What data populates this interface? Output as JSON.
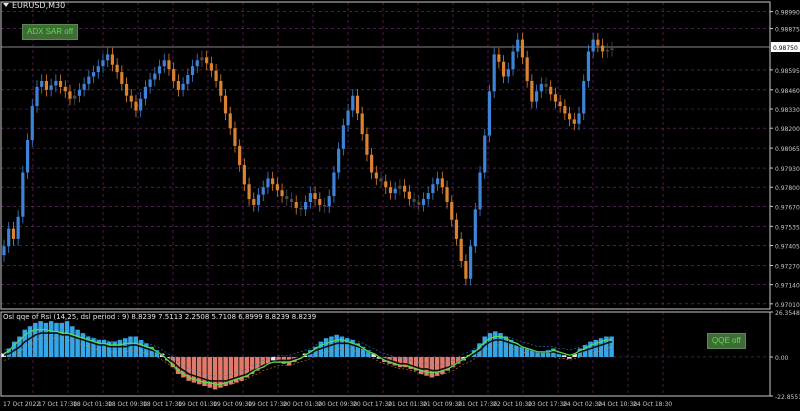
{
  "window": {
    "symbol": "EURUSD,M30"
  },
  "buttons": {
    "adx_sar": "ADX SAR off",
    "qqe": "QQE off"
  },
  "colors": {
    "background": "#000000",
    "grid": "#7a2f7a",
    "axis": "#c8c8c8",
    "bull": "#3f83d6",
    "bear": "#d98231",
    "neutral": "#4a4a4a",
    "hist_blue": "#35a7e8",
    "hist_red": "#e07a6a",
    "hist_white": "#e8e8e8",
    "rsi_line": "#55e04a",
    "qqe_line": "#101010",
    "level_blue": "#2f7fd0",
    "level_orange": "#d98231"
  },
  "chart_data": [
    {
      "type": "candlestick",
      "title": "EURUSD,M30",
      "ylim": [
        0.96975,
        0.99055
      ],
      "y_ticks": [
        "0.98990",
        "0.98875",
        "0.98595",
        "0.98460",
        "0.98330",
        "0.98200",
        "0.98065",
        "0.97930",
        "0.97800",
        "0.97670",
        "0.97535",
        "0.97405",
        "0.97270",
        "0.97140",
        "0.97010"
      ],
      "current_price": "0.98750",
      "x_tick_labels": [
        "17 Oct 2022",
        "17 Oct 17:30",
        "18 Oct 01:30",
        "18 Oct 09:30",
        "18 Oct 17:30",
        "19 Oct 01:30",
        "19 Oct 09:30",
        "19 Oct 17:30",
        "20 Oct 01:30",
        "20 Oct 09:30",
        "20 Oct 17:30",
        "21 Oct 01:30",
        "21 Oct 09:30",
        "21 Oct 17:30",
        "22 Oct 10:30",
        "23 Oct 17:30",
        "24 Oct 02:30",
        "24 Oct 10:30",
        "24 Oct 18:30"
      ],
      "grid": true,
      "series": [
        {
          "name": "close",
          "values": [
            0.974,
            0.9752,
            0.9745,
            0.976,
            0.979,
            0.9812,
            0.9835,
            0.9848,
            0.9852,
            0.9846,
            0.9849,
            0.9852,
            0.9848,
            0.9845,
            0.984,
            0.9842,
            0.9846,
            0.985,
            0.9855,
            0.9858,
            0.9862,
            0.9866,
            0.987,
            0.9863,
            0.9858,
            0.985,
            0.9842,
            0.9838,
            0.9832,
            0.984,
            0.9848,
            0.9853,
            0.9857,
            0.9862,
            0.9866,
            0.986,
            0.9852,
            0.9846,
            0.985,
            0.9856,
            0.9862,
            0.9866,
            0.9868,
            0.9864,
            0.9859,
            0.9852,
            0.9842,
            0.983,
            0.982,
            0.9808,
            0.9795,
            0.9782,
            0.9772,
            0.9768,
            0.9775,
            0.978,
            0.9786,
            0.9782,
            0.9778,
            0.9774,
            0.9772,
            0.977,
            0.9766,
            0.9765,
            0.977,
            0.9776,
            0.9772,
            0.9768,
            0.9767,
            0.9774,
            0.979,
            0.9806,
            0.9822,
            0.9832,
            0.9842,
            0.983,
            0.9816,
            0.9802,
            0.979,
            0.9786,
            0.9784,
            0.978,
            0.9776,
            0.9779,
            0.9781,
            0.9777,
            0.9772,
            0.977,
            0.9768,
            0.9772,
            0.9776,
            0.9782,
            0.9786,
            0.978,
            0.977,
            0.9758,
            0.9745,
            0.973,
            0.9718,
            0.974,
            0.9765,
            0.979,
            0.9815,
            0.9845,
            0.987,
            0.9865,
            0.9855,
            0.986,
            0.9872,
            0.988,
            0.9868,
            0.9852,
            0.9838,
            0.9845,
            0.985,
            0.9848,
            0.9843,
            0.9838,
            0.9835,
            0.983,
            0.9826,
            0.9823,
            0.983,
            0.9852,
            0.9872,
            0.988,
            0.9876,
            0.9872,
            0.9873,
            0.9874
          ]
        }
      ]
    },
    {
      "type": "histogram",
      "title": "Osl qqe of Rsi (14,25, dsl period : 9) 8.8239 7.5113 2.2508 5.7108 6.8999 8.8239 8.8239",
      "ylim": [
        -22.8551,
        26.3548
      ],
      "y_ticks": [
        "26.3548",
        "0.00",
        "-22.8551"
      ],
      "grid": true,
      "series": [
        {
          "name": "histogram",
          "values": [
            2,
            5,
            9,
            12,
            16,
            18,
            20,
            21,
            20,
            21,
            20,
            20,
            21,
            18,
            16,
            14,
            12,
            11,
            10,
            10,
            9,
            9,
            10,
            11,
            12,
            12,
            10,
            8,
            6,
            4,
            2,
            -2,
            -6,
            -10,
            -12,
            -14,
            -15,
            -16,
            -17,
            -18,
            -19,
            -18,
            -17,
            -16,
            -15,
            -14,
            -12,
            -10,
            -8,
            -6,
            -4,
            -2,
            -3,
            -4,
            -5,
            -3,
            -1,
            2,
            4,
            6,
            9,
            11,
            12,
            13,
            12,
            11,
            10,
            8,
            6,
            4,
            2,
            -1,
            -3,
            -4,
            -5,
            -6,
            -6,
            -7,
            -8,
            -10,
            -11,
            -12,
            -11,
            -10,
            -8,
            -6,
            -4,
            -2,
            1,
            4,
            8,
            12,
            14,
            15,
            14,
            12,
            10,
            8,
            6,
            5,
            4,
            3,
            3,
            4,
            5,
            3,
            1,
            -1,
            2,
            5,
            7,
            9,
            10,
            11,
            12,
            12
          ]
        },
        {
          "name": "rsi_line",
          "values": [
            2,
            4,
            7,
            10,
            13,
            15,
            16,
            16,
            16,
            15,
            15,
            14,
            14,
            13,
            12,
            11,
            10,
            9,
            8,
            8,
            7,
            7,
            7,
            8,
            8,
            8,
            7,
            6,
            5,
            3,
            1,
            -2,
            -5,
            -8,
            -10,
            -12,
            -13,
            -14,
            -15,
            -15,
            -16,
            -16,
            -15,
            -14,
            -13,
            -12,
            -11,
            -9,
            -7,
            -6,
            -4,
            -3,
            -3,
            -3,
            -3,
            -2,
            -1,
            1,
            3,
            5,
            7,
            8,
            9,
            10,
            10,
            9,
            8,
            7,
            5,
            3,
            2,
            0,
            -2,
            -3,
            -4,
            -5,
            -5,
            -6,
            -7,
            -8,
            -9,
            -9,
            -9,
            -8,
            -7,
            -5,
            -3,
            -1,
            1,
            3,
            6,
            9,
            11,
            12,
            12,
            11,
            9,
            8,
            6,
            5,
            4,
            3,
            3,
            3,
            4,
            3,
            2,
            1,
            2,
            4,
            5,
            7,
            8,
            9,
            10,
            10
          ]
        },
        {
          "name": "qqe_line",
          "values": [
            1,
            2,
            4,
            6,
            9,
            11,
            13,
            14,
            14,
            14,
            14,
            13,
            13,
            12,
            11,
            10,
            9,
            8,
            7,
            7,
            6,
            6,
            6,
            6,
            7,
            7,
            6,
            5,
            4,
            3,
            1,
            -1,
            -3,
            -6,
            -8,
            -10,
            -11,
            -12,
            -13,
            -14,
            -14,
            -14,
            -14,
            -13,
            -12,
            -11,
            -10,
            -8,
            -7,
            -5,
            -4,
            -3,
            -2,
            -2,
            -2,
            -1,
            0,
            1,
            2,
            4,
            5,
            6,
            7,
            8,
            8,
            8,
            7,
            6,
            5,
            3,
            2,
            0,
            -1,
            -2,
            -3,
            -4,
            -4,
            -5,
            -6,
            -7,
            -7,
            -8,
            -8,
            -7,
            -6,
            -5,
            -3,
            -1,
            0,
            2,
            4,
            7,
            9,
            10,
            10,
            9,
            8,
            7,
            6,
            5,
            4,
            3,
            3,
            3,
            3,
            2,
            2,
            1,
            2,
            3,
            4,
            5,
            6,
            7,
            8,
            9
          ]
        }
      ]
    }
  ]
}
